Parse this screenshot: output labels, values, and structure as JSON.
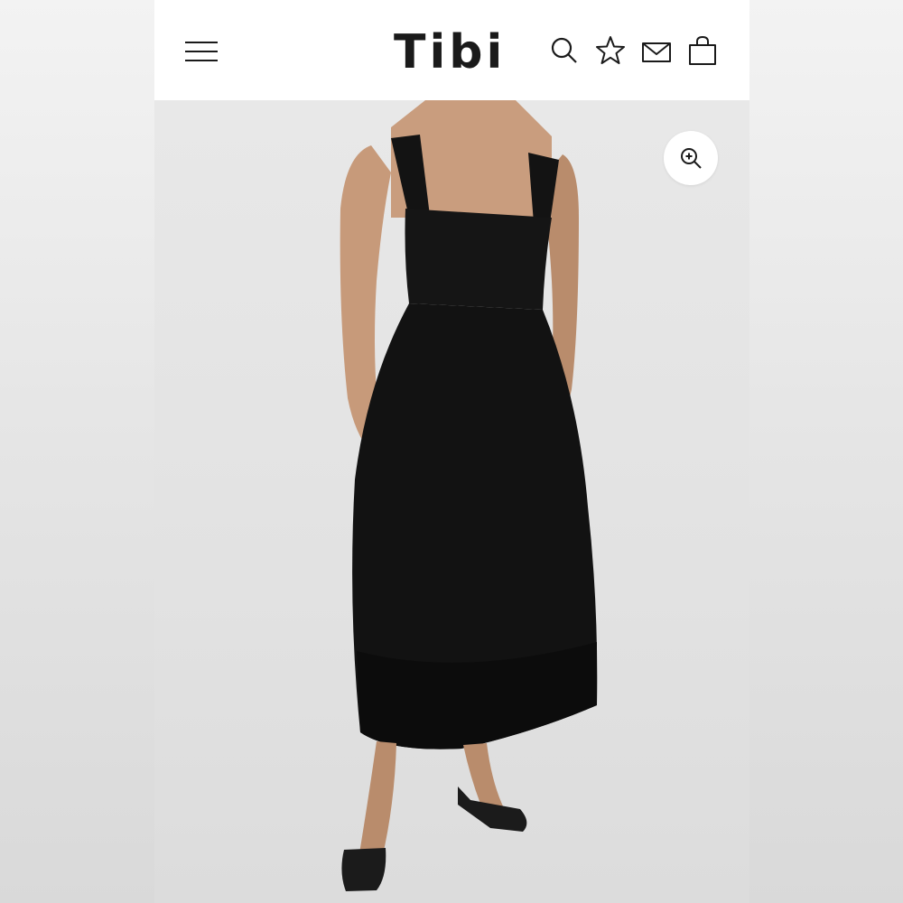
{
  "header": {
    "logo_text": "Tibi",
    "icons": {
      "menu": "hamburger-menu-icon",
      "search": "search-icon",
      "wishlist": "star-icon",
      "contact": "envelope-icon",
      "bag": "shopping-bag-icon"
    }
  },
  "product_image": {
    "zoom_icon": "zoom-in-icon"
  },
  "colors": {
    "header_bg": "#ffffff",
    "icon": "#1a1a1a",
    "dress": "#131313",
    "background": "#e4e4e4"
  }
}
